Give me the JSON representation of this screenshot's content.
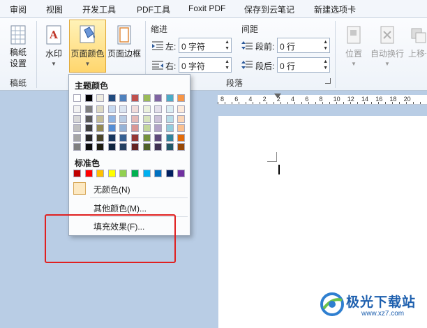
{
  "menu_tabs": [
    "审阅",
    "视图",
    "开发工具",
    "PDF工具",
    "Foxit PDF",
    "保存到云笔记",
    "新建选项卡"
  ],
  "ribbon": {
    "manuscript": {
      "button": "稿纸\n设置",
      "group": "稿纸"
    },
    "watermark": "水印",
    "page_color": "页面颜色",
    "page_border": "页面边框",
    "indent": {
      "title": "缩进",
      "left_label": "左:",
      "left_value": "0 字符",
      "right_label": "右:",
      "right_value": "0 字符"
    },
    "spacing": {
      "title": "间距",
      "before_label": "段前:",
      "before_value": "0 行",
      "after_label": "段后:",
      "after_value": "0 行"
    },
    "paragraph_group": "段落",
    "position": "位置",
    "auto_wrap": "自动换行",
    "bring_forward": "上移一"
  },
  "ruler_numbers": [
    "8",
    "6",
    "4",
    "2",
    "2",
    "4",
    "6",
    "8",
    "10",
    "12",
    "14",
    "16",
    "18",
    "20"
  ],
  "color_menu": {
    "theme_title": "主题颜色",
    "standard_title": "标准色",
    "no_color": "无颜色(N)",
    "more_colors": "其他颜色(M)...",
    "fill_effects": "填充效果(F)...",
    "theme_top": [
      "#ffffff",
      "#000000",
      "#eeece1",
      "#1f497d",
      "#4f81bd",
      "#c0504d",
      "#9bbb59",
      "#8064a2",
      "#4bacc6",
      "#f79646"
    ],
    "theme_shades": [
      [
        "#f2f2f2",
        "#d8d8d8",
        "#bfbfbf",
        "#a5a5a5",
        "#7f7f7f"
      ],
      [
        "#7f7f7f",
        "#595959",
        "#3f3f3f",
        "#262626",
        "#0c0c0c"
      ],
      [
        "#ddd9c3",
        "#c4bd97",
        "#938953",
        "#494429",
        "#1d1b10"
      ],
      [
        "#c6d9f0",
        "#8db3e2",
        "#548dd4",
        "#17365d",
        "#0f243e"
      ],
      [
        "#dbe5f1",
        "#b8cce4",
        "#95b3d7",
        "#366092",
        "#244061"
      ],
      [
        "#f2dcdb",
        "#e5b9b7",
        "#d99694",
        "#953734",
        "#632423"
      ],
      [
        "#ebf1dd",
        "#d7e3bc",
        "#c3d69b",
        "#76923c",
        "#4f6128"
      ],
      [
        "#e5e0ec",
        "#ccc1d9",
        "#b2a2c7",
        "#5f497a",
        "#3f3151"
      ],
      [
        "#dbeef3",
        "#b7dde8",
        "#92cddc",
        "#31859b",
        "#205867"
      ],
      [
        "#fdeada",
        "#fbd5b5",
        "#fac08f",
        "#e36c09",
        "#974806"
      ]
    ],
    "standard": [
      "#c00000",
      "#ff0000",
      "#ffc000",
      "#ffff00",
      "#92d050",
      "#00b050",
      "#00b0f0",
      "#0070c0",
      "#002060",
      "#7030a0"
    ]
  },
  "watermark": {
    "brand": "极光下载站",
    "url": "www.xz7.com"
  }
}
